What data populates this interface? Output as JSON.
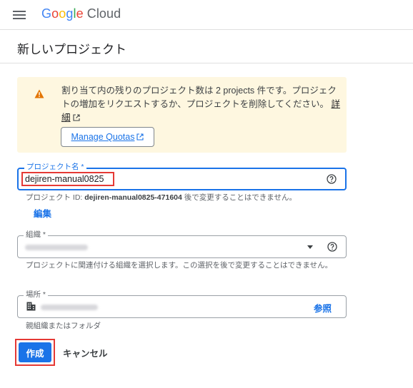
{
  "header": {
    "menu_icon": "hamburger-menu-icon",
    "logo_letters": [
      "G",
      "o",
      "o",
      "g",
      "l",
      "e"
    ],
    "logo_product": "Cloud"
  },
  "page": {
    "title": "新しいプロジェクト"
  },
  "quota_warning": {
    "icon": "warning-icon",
    "message": "割り当て内の残りのプロジェクト数は 2 projects 件です。プロジェクトの増加をリクエストするか、プロジェクトを削除してください。",
    "details_link": "詳細",
    "manage_button": "Manage Quotas",
    "accent_color": "#fef7e0"
  },
  "form": {
    "project_name": {
      "label": "プロジェクト名 *",
      "value": "dejiren-manual0825",
      "help_icon": "help-circle-icon"
    },
    "project_id_hint": {
      "prefix": "プロジェクト ID: ",
      "id": "dejiren-manual0825-471604",
      "suffix": " 後で変更することはできません。"
    },
    "edit_link": "編集",
    "organization": {
      "label": "組織 *",
      "value_redacted": true,
      "hint": "プロジェクトに関連付ける組織を選択します。この選択を後で変更することはできません。"
    },
    "location": {
      "label": "場所 *",
      "icon": "building-icon",
      "value_redacted": true,
      "browse": "参照",
      "hint": "親組織またはフォルダ"
    }
  },
  "actions": {
    "create": "作成",
    "cancel": "キャンセル"
  },
  "colors": {
    "primary": "#1a73e8",
    "highlight_border": "#e53935",
    "warning_icon": "#e37400"
  }
}
